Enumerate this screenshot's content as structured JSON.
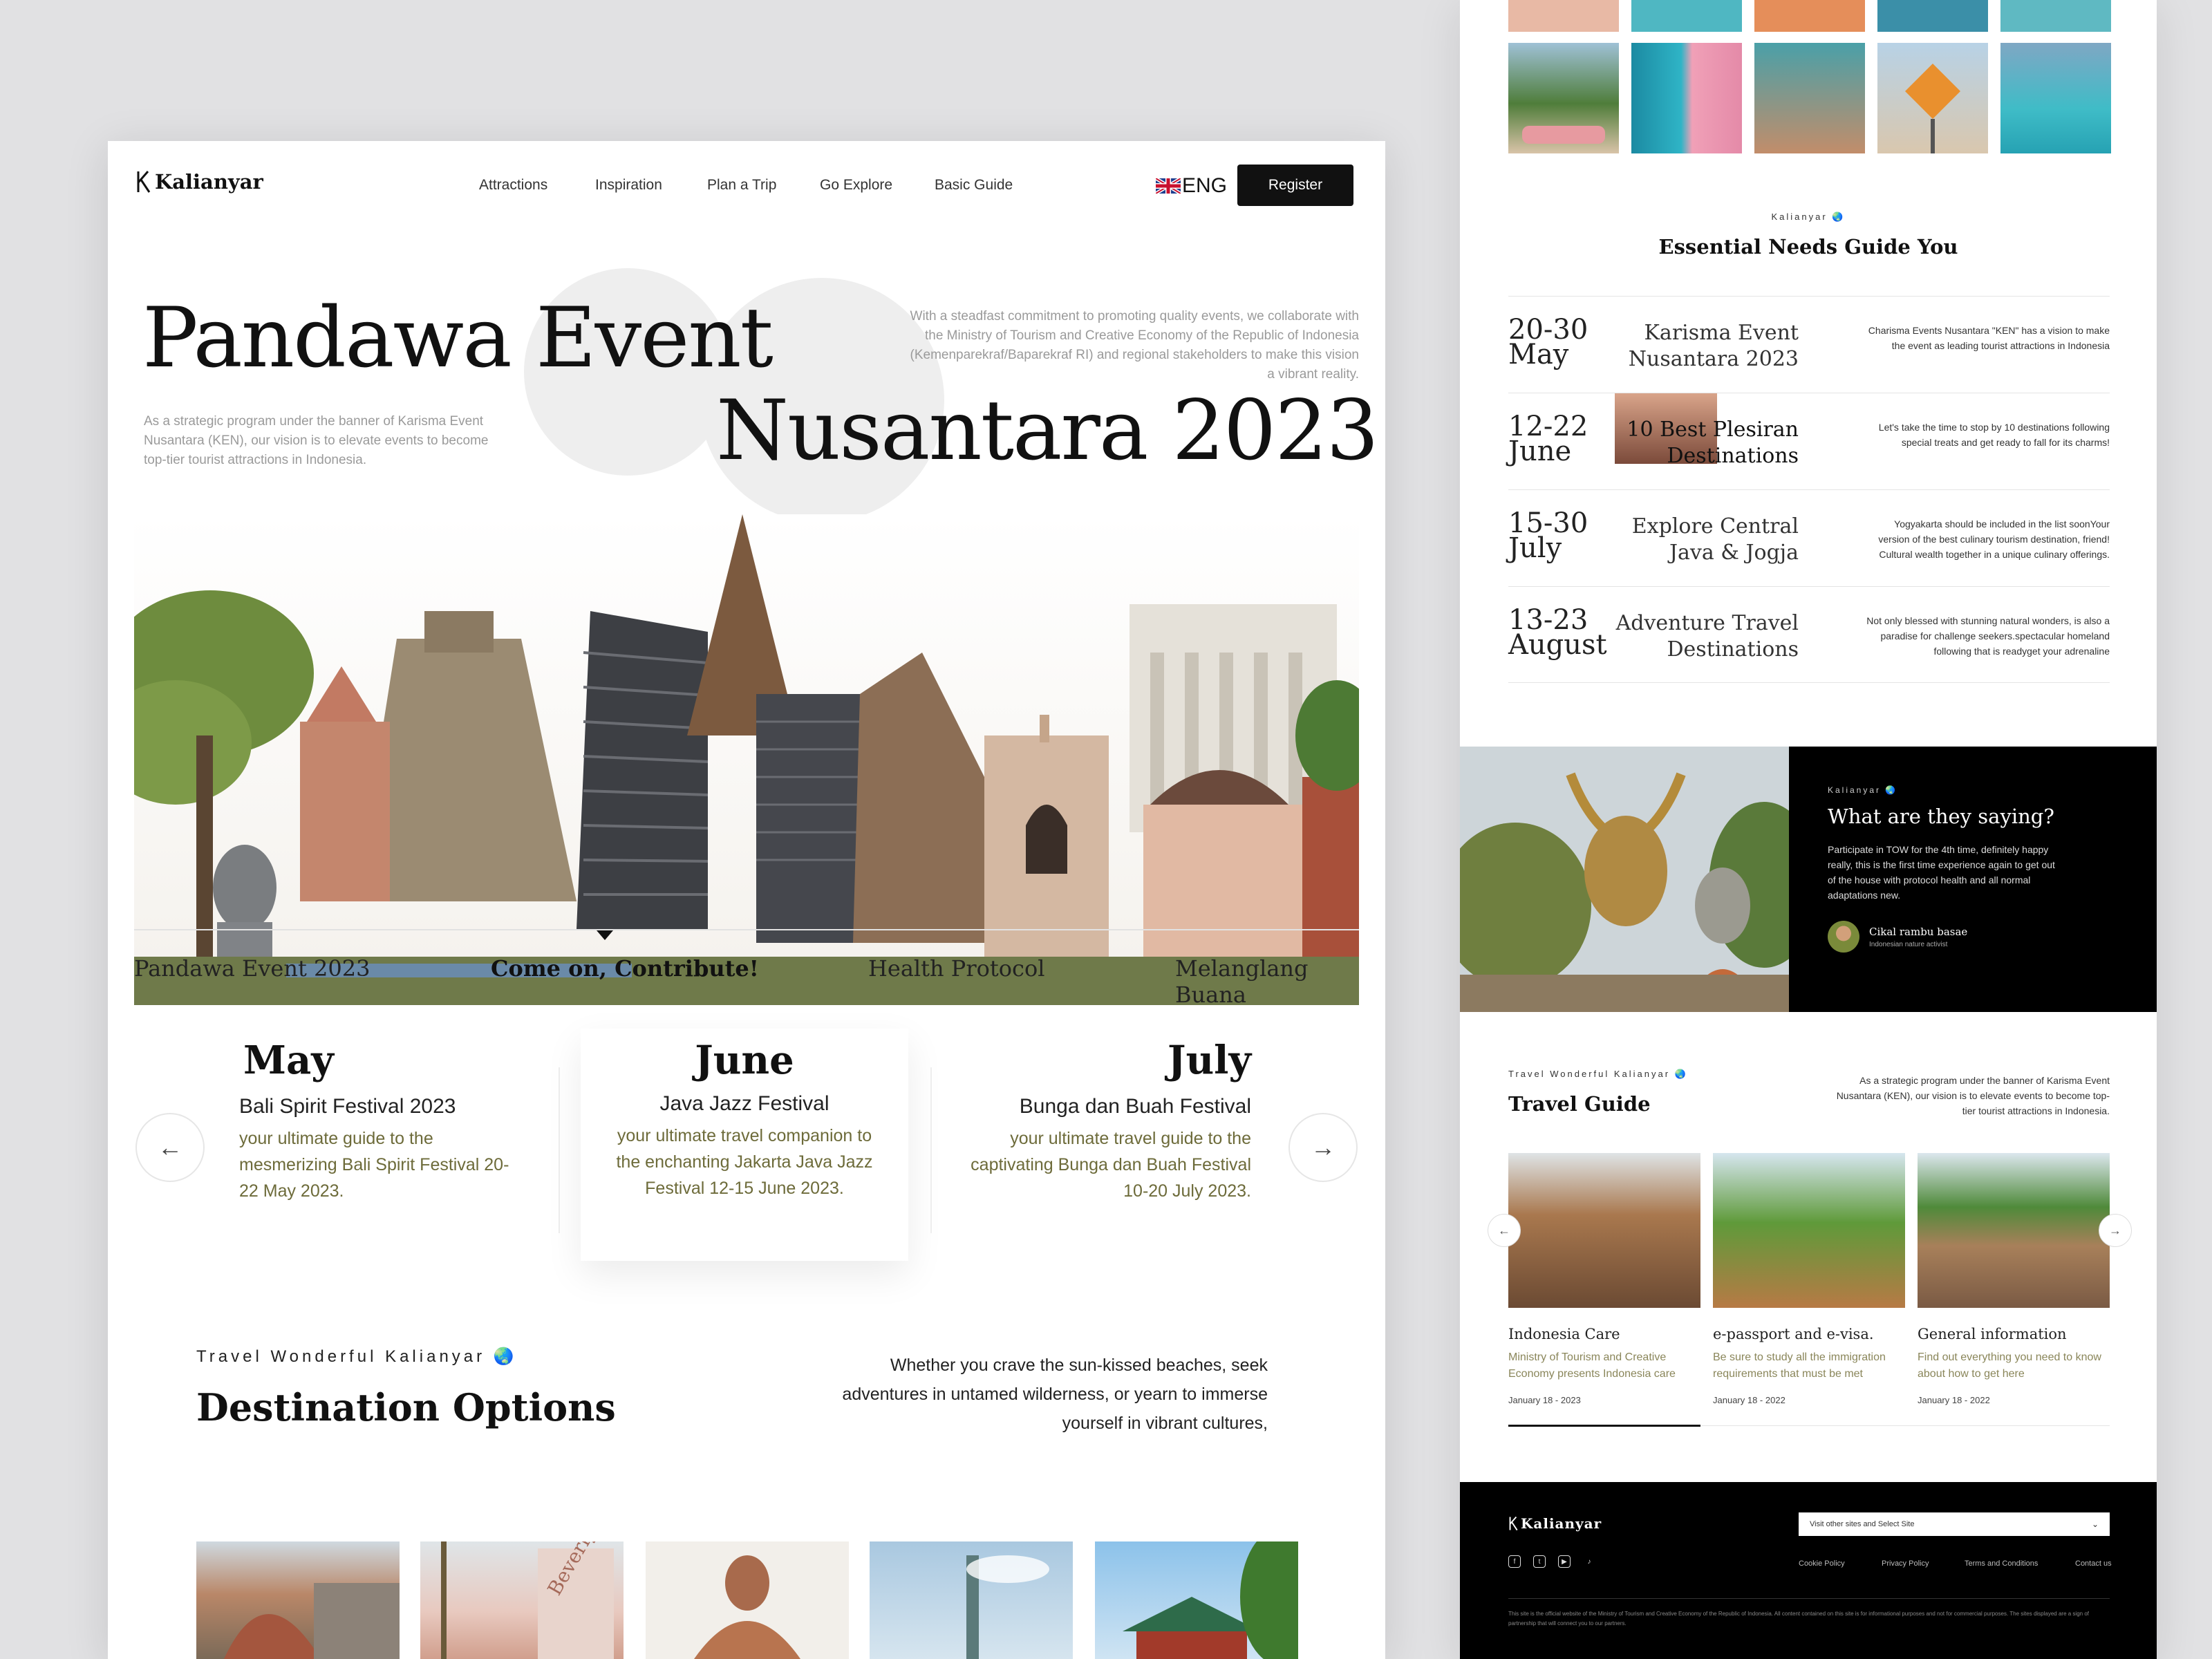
{
  "brand": {
    "name": "Kalianyar"
  },
  "nav": {
    "links": [
      "Attractions",
      "Inspiration",
      "Plan a Trip",
      "Go Explore",
      "Basic Guide"
    ],
    "language": "ENG",
    "register": "Register"
  },
  "hero": {
    "title_line1": "Pandawa Event",
    "title_line2": "Nusantara 2023",
    "intro_left": "As a strategic program under the banner of Karisma Event Nusantara (KEN), our vision is to elevate events to become top-tier tourist attractions in Indonesia.",
    "intro_right": "With a steadfast commitment to promoting quality events, we collaborate with the Ministry of Tourism and Creative Economy of the Republic of Indonesia (Kemenparekraf/Baparekraf RI) and regional stakeholders to make this vision a vibrant reality."
  },
  "tabs": {
    "items": [
      "Pandawa Event 2023",
      "Come on, Contribute!",
      "Health Protocol",
      "Melanglang Buana"
    ],
    "active_index": 1
  },
  "months": [
    {
      "month": "May",
      "event": "Bali Spirit Festival 2023",
      "desc": "your ultimate guide to the mesmerizing Bali Spirit Festival 20-22 May 2023."
    },
    {
      "month": "June",
      "event": "Java Jazz Festival",
      "desc": "your ultimate travel companion to the enchanting Jakarta Java Jazz Festival 12-15 June 2023."
    },
    {
      "month": "July",
      "event": "Bunga dan Buah Festival",
      "desc": "your ultimate travel guide to the captivating Bunga dan Buah Festival 10-20 July 2023."
    }
  ],
  "destinations": {
    "eyebrow": "Travel Wonderful Kalianyar 🌏",
    "title": "Destination Options",
    "desc": "Whether you crave the sun-kissed beaches, seek adventures in untamed wilderness, or yearn to immerse yourself in vibrant cultures,"
  },
  "essential": {
    "eyebrow": "Kalianyar 🌏",
    "title": "Essential Needs Guide You",
    "rows": [
      {
        "date1": "20-30",
        "date2": "May",
        "title": "Karisma Event Nusantara 2023",
        "desc": "Charisma Events Nusantara \"KEN\" has a vision to make the event as leading tourist attractions in Indonesia"
      },
      {
        "date1": "12-22",
        "date2": "June",
        "title": "10 Best Plesiran Destinations",
        "desc": "Let's take the time to stop by 10 destinations following special treats and get ready to fall for its charms!"
      },
      {
        "date1": "15-30",
        "date2": "July",
        "title": "Explore Central Java & Jogja",
        "desc": "Yogyakarta should be included in the list soonYour version of the best culinary tourism destination, friend! Cultural wealth together in a unique culinary offerings."
      },
      {
        "date1": "13-23",
        "date2": "August",
        "title": "Adventure Travel Destinations",
        "desc": "Not only blessed with stunning natural wonders, is also a paradise for challenge seekers.spectacular homeland following that is readyget your adrenaline"
      }
    ]
  },
  "testimonial": {
    "eyebrow": "Kalianyar 🌏",
    "title": "What are they saying?",
    "quote": "Participate in TOW for the 4th time, definitely happy really, this is the first time experience again to get out of the house with protocol health and all normal adaptations new.",
    "author": "Cikal rambu basae",
    "role": "Indonesian nature activist"
  },
  "travel_guide": {
    "eyebrow": "Travel Wonderful Kalianyar 🌏",
    "title": "Travel Guide",
    "desc": "As a strategic program under the banner of Karisma Event Nusantara (KEN), our vision is to elevate events to become top-tier tourist attractions in Indonesia.",
    "cards": [
      {
        "title": "Indonesia Care",
        "desc": "Ministry of Tourism and Creative Economy presents Indonesia care",
        "date": "January 18 - 2023"
      },
      {
        "title": "e-passport and e-visa.",
        "desc": "Be sure to study all the immigration requirements that must be met",
        "date": "January 18 - 2022"
      },
      {
        "title": "General information",
        "desc": "Find out everything you need to know about how to get here",
        "date": "January 18 - 2022"
      }
    ]
  },
  "footer": {
    "brand": "Kalianyar",
    "select_label": "Visit other sites and Select Site",
    "links": [
      "Cookie Policy",
      "Privacy Policy",
      "Terms and Conditions",
      "Contact us"
    ],
    "notice": "This site is the official website of the Ministry of Tourism and Creative Economy of the Republic of Indonesia. All content contained on this site is for informational purposes and not for commercial purposes. The sites displayed are a sign of partnership that will connect you to our partners."
  },
  "icons": {
    "brand": "logo-mark-icon",
    "flag": "uk-flag-icon",
    "prev": "arrow-left-icon",
    "next": "arrow-right-icon",
    "dropdown": "chevron-down-icon",
    "social": [
      "facebook-icon",
      "twitter-icon",
      "youtube-icon",
      "tiktok-icon"
    ]
  }
}
